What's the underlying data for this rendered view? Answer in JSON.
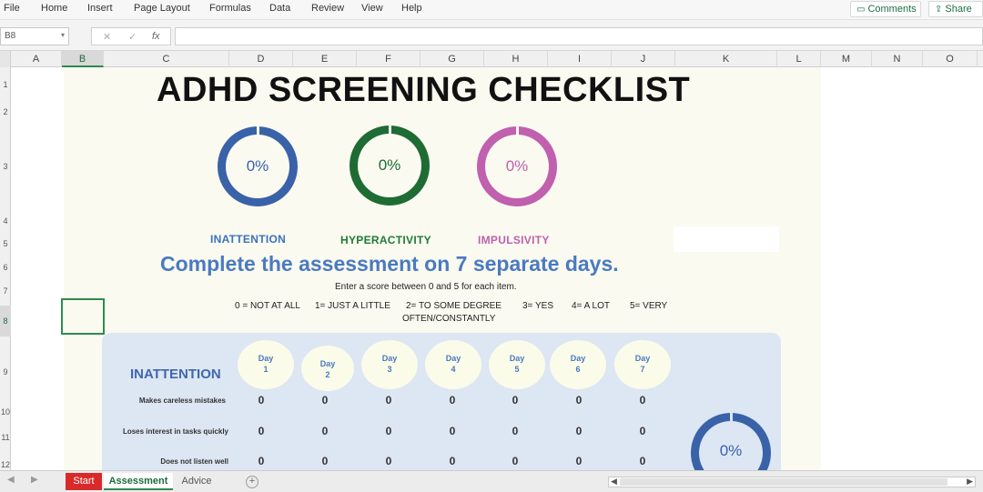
{
  "ribbon": {
    "menu": [
      "File",
      "Home",
      "Insert",
      "Page Layout",
      "Formulas",
      "Data",
      "Review",
      "View",
      "Help"
    ],
    "comments_label": "Comments",
    "share_label": "Share"
  },
  "formula_bar": {
    "name_box": "B8",
    "cancel_glyph": "✕",
    "enter_glyph": "✓",
    "fx_glyph": "fx",
    "formula": ""
  },
  "columns": [
    "A",
    "B",
    "C",
    "D",
    "E",
    "F",
    "G",
    "H",
    "I",
    "J",
    "K",
    "L",
    "M",
    "N",
    "O"
  ],
  "rows": [
    "1",
    "2",
    "3",
    "4",
    "5",
    "6",
    "7",
    "8",
    "9",
    "10",
    "11",
    "12"
  ],
  "sheet": {
    "title": "ADHD SCREENING CHECKLIST",
    "gauges": [
      {
        "label": "INATTENTION",
        "value": "0%",
        "color": "#3a62a8"
      },
      {
        "label": "HYPERACTIVITY",
        "value": "0%",
        "color": "#1f6b34"
      },
      {
        "label": "IMPULSIVITY",
        "value": "0%",
        "color": "#c060ae"
      }
    ],
    "subtitle": "Complete the assessment on 7 separate days.",
    "instruction": "Enter a score between 0 and 5 for each item.",
    "legend": [
      "0 = NOT AT ALL",
      "1= JUST A LITTLE",
      "2= TO SOME DEGREE",
      "OFTEN/CONSTANTLY",
      "3= YES",
      "4= A LOT",
      "5= VERY"
    ],
    "table": {
      "title": "INATTENTION",
      "days": [
        {
          "word": "Day",
          "num": "1"
        },
        {
          "word": "Day",
          "num": "2"
        },
        {
          "word": "Day",
          "num": "3"
        },
        {
          "word": "Day",
          "num": "4"
        },
        {
          "word": "Day",
          "num": "5"
        },
        {
          "word": "Day",
          "num": "6"
        },
        {
          "word": "Day",
          "num": "7"
        }
      ],
      "items": [
        {
          "label": "Makes careless mistakes",
          "scores": [
            "0",
            "0",
            "0",
            "0",
            "0",
            "0",
            "0"
          ]
        },
        {
          "label": "Loses interest in tasks quickly",
          "scores": [
            "0",
            "0",
            "0",
            "0",
            "0",
            "0",
            "0"
          ]
        },
        {
          "label": "Does not listen well",
          "scores": [
            "0",
            "0",
            "0",
            "0",
            "0",
            "0",
            "0"
          ]
        }
      ],
      "summary_value": "0%",
      "summary_color": "#3a62a8"
    }
  },
  "tabs": [
    "Start",
    "Assessment",
    "Advice"
  ],
  "tab_add": "+",
  "nav_prev": "◀",
  "nav_next": "▶"
}
